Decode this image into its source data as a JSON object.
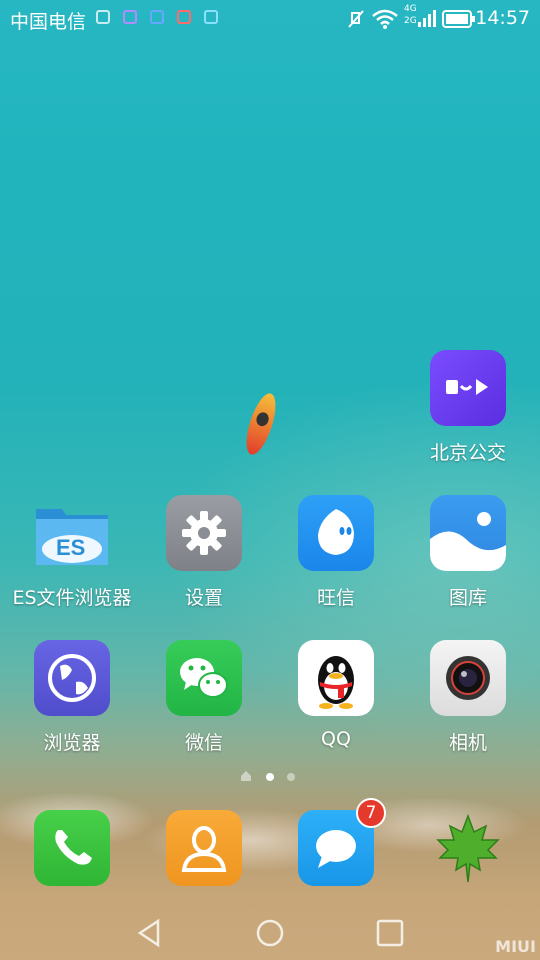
{
  "status_bar": {
    "carrier": "中国电信",
    "network_4g": "4G",
    "network_2g": "2G",
    "time": "14:57",
    "notification_icons": [
      "gallery-icon",
      "keyboard-icon",
      "sim-icon",
      "huawei-icon",
      "shield-icon"
    ]
  },
  "apps": {
    "beijing_bus": {
      "label": "北京公交"
    },
    "es_browser": {
      "label": "ES文件浏览器"
    },
    "settings": {
      "label": "设置"
    },
    "wangxin": {
      "label": "旺信"
    },
    "gallery": {
      "label": "图库"
    },
    "browser": {
      "label": "浏览器"
    },
    "wechat": {
      "label": "微信"
    },
    "qq": {
      "label": "QQ"
    },
    "camera": {
      "label": "相机"
    }
  },
  "dock": {
    "phone": {
      "label": ""
    },
    "contacts": {
      "label": ""
    },
    "messages": {
      "label": "",
      "badge": "7"
    },
    "greenify": {
      "label": ""
    }
  },
  "page_indicator": {
    "pages": 2,
    "current": 1
  },
  "watermark": "MIUI",
  "colors": {
    "beijing_bus": "#6a3df0",
    "settings": "#8c8f95",
    "wangxin": "#1c8ff0",
    "gallery": "#2f8ee8",
    "browser": "#5c5ad8",
    "wechat": "#2bc34f",
    "phone": "#39c13b",
    "contacts": "#f4a02c",
    "messages": "#1ea2f0",
    "badge": "#e5392b"
  }
}
